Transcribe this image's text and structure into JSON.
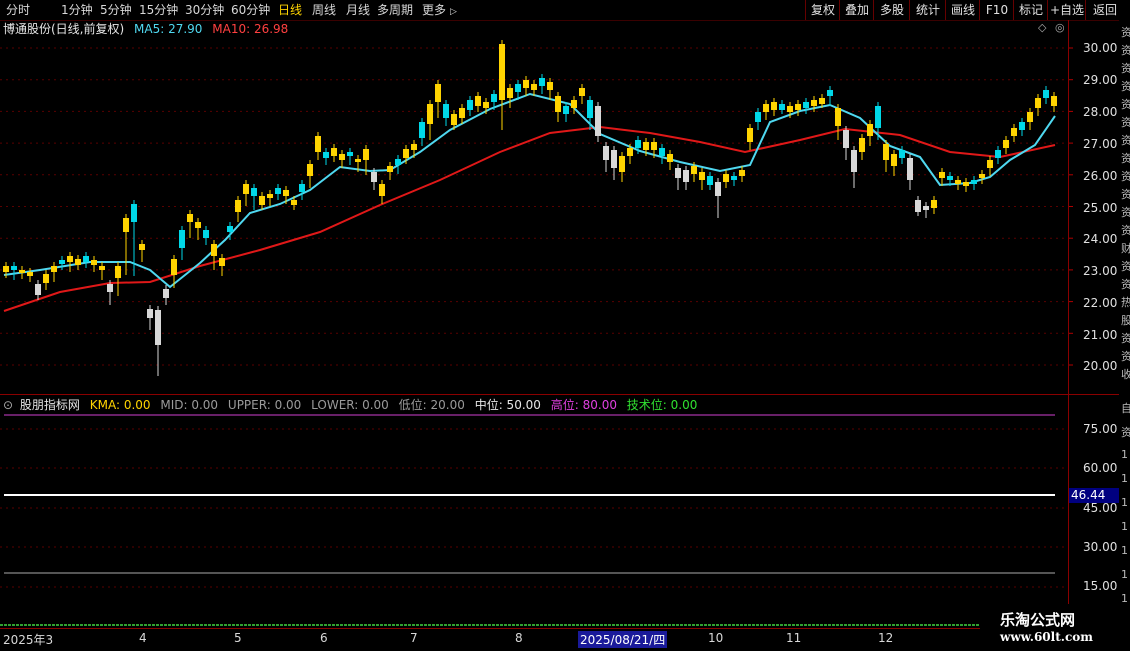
{
  "toolbar": {
    "periods": [
      "分时",
      "1分钟",
      "5分钟",
      "15分钟",
      "30分钟",
      "60分钟",
      "日线",
      "周线",
      "月线",
      "多周期",
      "更多"
    ],
    "active_period": "日线",
    "more_suffix": "▷",
    "buttons": [
      "复权",
      "叠加",
      "多股",
      "统计",
      "画线",
      "F10",
      "标记",
      "+自选",
      "返回"
    ]
  },
  "main_title": {
    "name": "博通股份(日线,前复权)",
    "ma5": "MA5: 27.90",
    "ma10": "MA10: 26.98"
  },
  "price_axis": [
    "30.00",
    "29.00",
    "28.00",
    "27.00",
    "26.00",
    "25.00",
    "24.00",
    "23.00",
    "22.00",
    "21.00",
    "20.00"
  ],
  "indicator": {
    "name": "股朋指标网",
    "kma": "KMA: 0.00",
    "mid": "MID: 0.00",
    "upper": "UPPER: 0.00",
    "lower": "LOWER: 0.00",
    "low": "低位: 20.00",
    "middle": "中位: 50.00",
    "high": "高位: 80.00",
    "tech": "技术位: 0.00",
    "axis": [
      "75.00",
      "60.00",
      "45.00",
      "30.00",
      "15.00"
    ],
    "current": "46.44"
  },
  "xaxis": {
    "labels": [
      "2025年3",
      "4",
      "5",
      "6",
      "7",
      "8",
      "10",
      "11",
      "12"
    ],
    "crosshair_date": "2025/08/21/四"
  },
  "side_glyphs": [
    "资",
    "资",
    "资",
    "资",
    "资",
    "资",
    "资",
    "资",
    "资",
    "资",
    "资",
    "资",
    "财",
    "资",
    "资",
    "热",
    "股",
    "资",
    "资",
    "收"
  ],
  "side_glyphs_lower": [
    "自",
    "资",
    "1",
    "1",
    "1",
    "1",
    "1",
    "1",
    "1"
  ],
  "watermark": {
    "line1": "乐淘公式网",
    "line2": "www.60lt.com"
  },
  "colors": {
    "up": "#ffd400",
    "down": "#00d8e8",
    "ma5": "#4fd8f0",
    "ma10": "#e01818",
    "grid": "#5a0000"
  }
}
